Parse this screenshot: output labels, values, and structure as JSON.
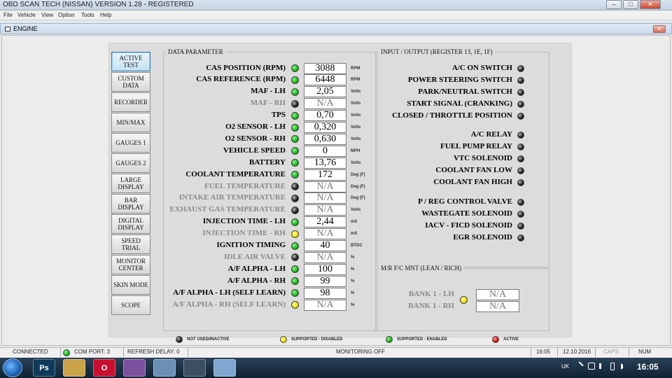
{
  "app": {
    "title": "OBD SCAN TECH (NISSAN) VERSION 1.28 -  REGISTERED",
    "window_controls": {
      "minimize": "–",
      "maximize": "□",
      "close": "✕"
    }
  },
  "menu": [
    "File",
    "Vehicle",
    "View",
    "Option",
    "Tools",
    "Help"
  ],
  "child_window": {
    "title": "ENGINE",
    "close": "✕"
  },
  "nav": [
    {
      "label": "ACTIVE TEST",
      "active": true
    },
    {
      "label": "CUSTOM DATA"
    },
    {
      "label": "RECORDER"
    },
    {
      "label": "MIN/MAX"
    },
    {
      "label": "GAUGES 1"
    },
    {
      "label": "GAUGES 2"
    },
    {
      "label": "LARGE DISPLAY"
    },
    {
      "label": "BAR DISPLAY"
    },
    {
      "label": "DIGITAL DISPLAY"
    },
    {
      "label": "SPEED TRIAL"
    },
    {
      "label": "MONITOR CENTER"
    },
    {
      "label": "SKIN MODE"
    },
    {
      "label": "SCOPE"
    }
  ],
  "data_parameter": {
    "title": "DATA PARAMETER",
    "rows": [
      {
        "label": "CAS POSITION (RPM)",
        "status": "green",
        "value": "3088",
        "unit": "RPM",
        "disabled": false
      },
      {
        "label": "CAS REFERENCE (RPM)",
        "status": "green",
        "value": "6448",
        "unit": "RPM",
        "disabled": false
      },
      {
        "label": "MAF - LH",
        "status": "green",
        "value": "2,05",
        "unit": "Volts",
        "disabled": false
      },
      {
        "label": "MAF - RH",
        "status": "black",
        "value": "N/A",
        "unit": "Volts",
        "disabled": true
      },
      {
        "label": "TPS",
        "status": "green",
        "value": "0,70",
        "unit": "Volts",
        "disabled": false
      },
      {
        "label": "O2 SENSOR - LH",
        "status": "green",
        "value": "0,320",
        "unit": "Volts",
        "disabled": false
      },
      {
        "label": "O2 SENSOR - RH",
        "status": "green",
        "value": "0,630",
        "unit": "Volts",
        "disabled": false
      },
      {
        "label": "VEHICLE SPEED",
        "status": "green",
        "value": "0",
        "unit": "MPH",
        "disabled": false
      },
      {
        "label": "BATTERY",
        "status": "green",
        "value": "13,76",
        "unit": "Volts",
        "disabled": false
      },
      {
        "label": "COOLANT TEMPERATURE",
        "status": "green",
        "value": "172",
        "unit": "Deg (F)",
        "disabled": false
      },
      {
        "label": "FUEL TEMPERATURE",
        "status": "black",
        "value": "N/A",
        "unit": "Deg (F)",
        "disabled": true
      },
      {
        "label": "INTAKE AIR TEMPERATURE",
        "status": "black",
        "value": "N/A",
        "unit": "Deg (F)",
        "disabled": true
      },
      {
        "label": "EXHAUST GAS TEMPERATURE",
        "status": "black",
        "value": "N/A",
        "unit": "Volts",
        "disabled": true
      },
      {
        "label": "INJECTION TIME - LH",
        "status": "green",
        "value": "2,44",
        "unit": "mS",
        "disabled": false
      },
      {
        "label": "INJECTION TIME - RH",
        "status": "yellow",
        "value": "N/A",
        "unit": "mS",
        "disabled": true
      },
      {
        "label": "IGNITION TIMING",
        "status": "green",
        "value": "40",
        "unit": "BTDC",
        "disabled": false
      },
      {
        "label": "IDLE AIR VALVE",
        "status": "black",
        "value": "N/A",
        "unit": "%",
        "disabled": true
      },
      {
        "label": "A/F ALPHA - LH",
        "status": "green",
        "value": "100",
        "unit": "%",
        "disabled": false
      },
      {
        "label": "A/F ALPHA - RH",
        "status": "green",
        "value": "99",
        "unit": "%",
        "disabled": false
      },
      {
        "label": "A/F ALPHA - LH (SELF LEARN)",
        "status": "green",
        "value": "98",
        "unit": "%",
        "disabled": false
      },
      {
        "label": "A/F ALPHA - RH (SELF LEARN)",
        "status": "yellow",
        "value": "N/A",
        "unit": "%",
        "disabled": true
      }
    ]
  },
  "io": {
    "title": "INPUT / OUTPUT (REGISTER 13, 1E, 1F)",
    "groups": [
      [
        {
          "label": "A/C ON SWITCH",
          "status": "black"
        },
        {
          "label": "POWER STEERING SWITCH",
          "status": "black"
        },
        {
          "label": "PARK/NEUTRAL SWITCH",
          "status": "black"
        },
        {
          "label": "START SIGNAL (CRANKING)",
          "status": "black"
        },
        {
          "label": "CLOSED / THROTTLE POSITION",
          "status": "black"
        }
      ],
      [
        {
          "label": "A/C RELAY",
          "status": "black"
        },
        {
          "label": "FUEL PUMP RELAY",
          "status": "black"
        },
        {
          "label": "VTC SOLENOID",
          "status": "black"
        },
        {
          "label": "COOLANT FAN LOW",
          "status": "black"
        },
        {
          "label": "COOLANT FAN HIGH",
          "status": "black"
        }
      ],
      [
        {
          "label": "P / REG CONTROL VALVE",
          "status": "black"
        },
        {
          "label": "WASTEGATE SOLENOID",
          "status": "black"
        },
        {
          "label": "IACV - FICD SOLENOID",
          "status": "black"
        },
        {
          "label": "EGR SOLENOID",
          "status": "black"
        }
      ]
    ]
  },
  "mrfc": {
    "title": "M/R F/C MNT (LEAN / RICH)",
    "banks": [
      {
        "label": "BANK 1 - LH",
        "value": "N/A"
      },
      {
        "label": "BANK 1 - RH",
        "value": "N/A"
      }
    ],
    "status": "yellow"
  },
  "legend": [
    {
      "status": "black",
      "label": "NOT USED/INACTIVE"
    },
    {
      "status": "yellow",
      "label": "SUPPORTED - DISABLED"
    },
    {
      "status": "green",
      "label": "SUPPORTED - ENABLED"
    },
    {
      "status": "red",
      "label": "ACTIVE"
    }
  ],
  "statusbar": {
    "connection": "CONNECTED",
    "com_port": "COM PORT:  3",
    "refresh_delay": "REFRESH DELAY:  0",
    "monitoring": "MONITORING OFF",
    "time": "16:05",
    "date": "12.10.2016",
    "caps": "CAPS",
    "num": "NUM"
  },
  "taskbar": {
    "apps": [
      {
        "name": "photoshop",
        "label": "Ps",
        "color": "#0f3a5a"
      },
      {
        "name": "file-explorer",
        "label": "",
        "color": "#c9a24a"
      },
      {
        "name": "opera",
        "label": "O",
        "color": "#c8102e"
      },
      {
        "name": "viber",
        "label": "",
        "color": "#7b519d"
      },
      {
        "name": "settings-tool",
        "label": "",
        "color": "#6c8fb8"
      },
      {
        "name": "obd-app",
        "label": "",
        "color": "#3d4e60"
      },
      {
        "name": "paint",
        "label": "",
        "color": "#7fa6cf"
      }
    ],
    "lang": "UK",
    "clock": "16:05"
  }
}
